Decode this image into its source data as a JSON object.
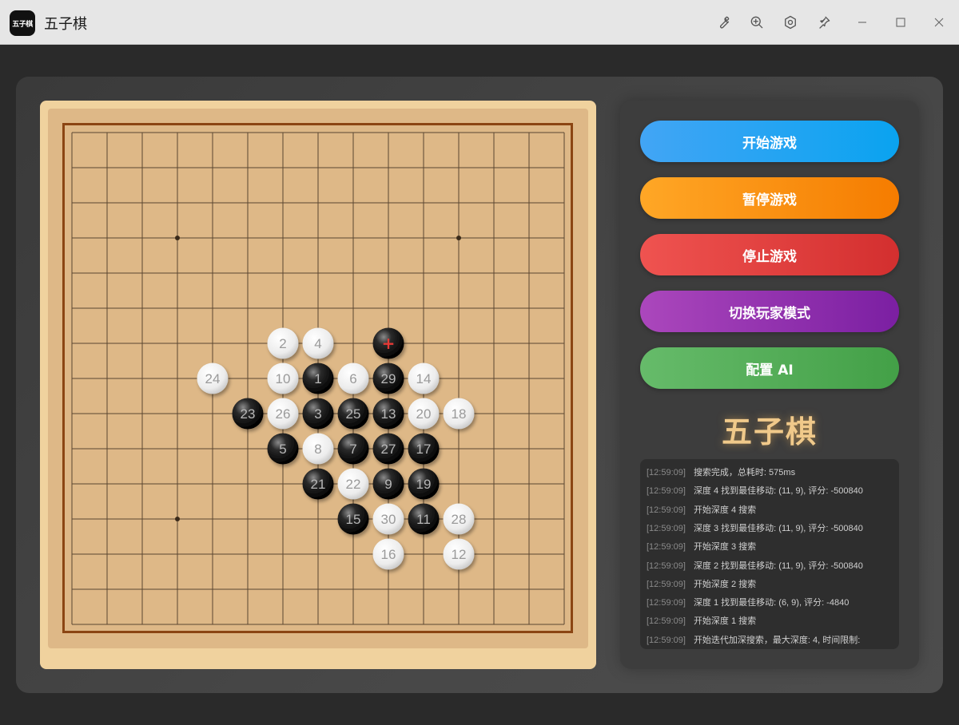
{
  "window": {
    "icon_text": "五子棋",
    "title": "五子棋",
    "toolbar_icons": [
      "wrench-icon",
      "zoom-in-icon",
      "settings-hex-icon",
      "pin-icon"
    ]
  },
  "board": {
    "size": 15,
    "star_points": [
      [
        3,
        3
      ],
      [
        11,
        3
      ],
      [
        3,
        11
      ]
    ],
    "last_move_marker_color": "#e53935",
    "stones": [
      {
        "n": 1,
        "x": 7,
        "y": 7,
        "color": "black"
      },
      {
        "n": 2,
        "x": 6,
        "y": 6,
        "color": "white"
      },
      {
        "n": 3,
        "x": 7,
        "y": 8,
        "color": "black"
      },
      {
        "n": 4,
        "x": 7,
        "y": 6,
        "color": "white"
      },
      {
        "n": 5,
        "x": 6,
        "y": 9,
        "color": "black"
      },
      {
        "n": 6,
        "x": 8,
        "y": 7,
        "color": "white"
      },
      {
        "n": 7,
        "x": 8,
        "y": 9,
        "color": "black"
      },
      {
        "n": 8,
        "x": 7,
        "y": 9,
        "color": "white"
      },
      {
        "n": 9,
        "x": 9,
        "y": 10,
        "color": "black"
      },
      {
        "n": 10,
        "x": 6,
        "y": 7,
        "color": "white"
      },
      {
        "n": 11,
        "x": 10,
        "y": 11,
        "color": "black"
      },
      {
        "n": 12,
        "x": 11,
        "y": 12,
        "color": "white"
      },
      {
        "n": 13,
        "x": 9,
        "y": 8,
        "color": "black"
      },
      {
        "n": 14,
        "x": 10,
        "y": 7,
        "color": "white"
      },
      {
        "n": 15,
        "x": 8,
        "y": 11,
        "color": "black"
      },
      {
        "n": 16,
        "x": 9,
        "y": 12,
        "color": "white"
      },
      {
        "n": 17,
        "x": 10,
        "y": 9,
        "color": "black"
      },
      {
        "n": 18,
        "x": 11,
        "y": 8,
        "color": "white"
      },
      {
        "n": 19,
        "x": 10,
        "y": 10,
        "color": "black"
      },
      {
        "n": 20,
        "x": 10,
        "y": 8,
        "color": "white"
      },
      {
        "n": 21,
        "x": 7,
        "y": 10,
        "color": "black"
      },
      {
        "n": 22,
        "x": 8,
        "y": 10,
        "color": "white"
      },
      {
        "n": 23,
        "x": 5,
        "y": 8,
        "color": "black"
      },
      {
        "n": 24,
        "x": 4,
        "y": 7,
        "color": "white"
      },
      {
        "n": 25,
        "x": 8,
        "y": 8,
        "color": "black"
      },
      {
        "n": 26,
        "x": 6,
        "y": 8,
        "color": "white"
      },
      {
        "n": 27,
        "x": 9,
        "y": 9,
        "color": "black"
      },
      {
        "n": 28,
        "x": 11,
        "y": 11,
        "color": "white"
      },
      {
        "n": 29,
        "x": 9,
        "y": 7,
        "color": "black"
      },
      {
        "n": 30,
        "x": 9,
        "y": 11,
        "color": "white"
      },
      {
        "n": null,
        "x": 9,
        "y": 6,
        "color": "black",
        "last": true
      }
    ]
  },
  "controls": {
    "start_label": "开始游戏",
    "pause_label": "暂停游戏",
    "stop_label": "停止游戏",
    "switch_mode_label": "切换玩家模式",
    "config_ai_label": "配置 AI"
  },
  "brand_title": "五子棋",
  "colors": {
    "board": "#deb887",
    "board_border": "#8b4513",
    "start": "#2196f3",
    "pause": "#ff9800",
    "stop": "#f44336",
    "mode": "#9c27b0",
    "ai": "#4caf50",
    "brand": "#f0c98a"
  },
  "log": [
    {
      "time": "[12:59:09]",
      "text": "搜索完成，总耗时: 575ms"
    },
    {
      "time": "[12:59:09]",
      "text": "深度 4 找到最佳移动: (11, 9), 评分: -500840"
    },
    {
      "time": "[12:59:09]",
      "text": "开始深度 4 搜索"
    },
    {
      "time": "[12:59:09]",
      "text": "深度 3 找到最佳移动: (11, 9), 评分: -500840"
    },
    {
      "time": "[12:59:09]",
      "text": "开始深度 3 搜索"
    },
    {
      "time": "[12:59:09]",
      "text": "深度 2 找到最佳移动: (11, 9), 评分: -500840"
    },
    {
      "time": "[12:59:09]",
      "text": "开始深度 2 搜索"
    },
    {
      "time": "[12:59:09]",
      "text": "深度 1 找到最佳移动: (6, 9), 评分: -4840"
    },
    {
      "time": "[12:59:09]",
      "text": "开始深度 1 搜索"
    },
    {
      "time": "[12:59:09]",
      "text": "开始迭代加深搜索，最大深度: 4, 时间限制:"
    }
  ]
}
